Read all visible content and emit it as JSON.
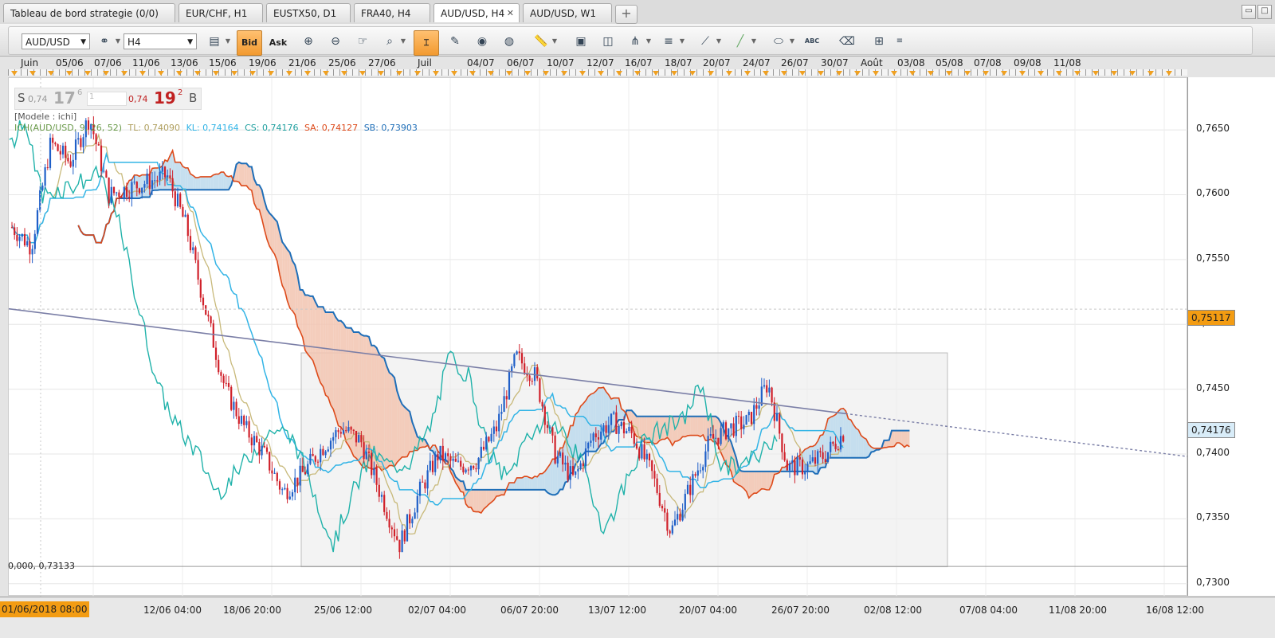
{
  "tabs": [
    {
      "label": "Tableau de bord strategie (0/0)",
      "active": false
    },
    {
      "label": "EUR/CHF, H1",
      "active": false
    },
    {
      "label": "EUSTX50, D1",
      "active": false
    },
    {
      "label": "FRA40, H4",
      "active": false
    },
    {
      "label": "AUD/USD, H4",
      "active": true
    },
    {
      "label": "AUD/USD, W1",
      "active": false
    }
  ],
  "tab_add_label": "+",
  "toolbar": {
    "instrument": "AUD/USD",
    "timeframe": "H4",
    "bid_label": "Bid",
    "ask_label": "Ask",
    "text_tool_label": "ABC",
    "icons": [
      "chart-type-icon",
      "bar-style-icon",
      "zoom-in-icon",
      "zoom-out-icon",
      "hand-icon",
      "zoom-fit-icon",
      "crosshair-icon",
      "template-icon",
      "eye-icon",
      "globe-icon",
      "ruler-icon",
      "image-icon",
      "window-icon",
      "pitchfork-icon",
      "lines-icon",
      "trendline-icon",
      "pen-icon",
      "ellipse-icon",
      "text-icon",
      "eraser-icon",
      "hierarchy-icon",
      "more-icon"
    ]
  },
  "date_axis_top": [
    "Juin",
    "05/06",
    "07/06",
    "11/06",
    "13/06",
    "15/06",
    "19/06",
    "21/06",
    "25/06",
    "27/06",
    "Juil",
    "04/07",
    "06/07",
    "10/07",
    "12/07",
    "16/07",
    "18/07",
    "20/07",
    "24/07",
    "26/07",
    "30/07",
    "Août",
    "03/08",
    "05/08",
    "07/08",
    "09/08",
    "11/08"
  ],
  "time_axis_bottom": [
    "01/06/2018 08:00",
    "12/06 04:00",
    "18/06 20:00",
    "25/06 12:00",
    "02/07 04:00",
    "06/07 20:00",
    "13/07 12:00",
    "20/07 04:00",
    "26/07 20:00",
    "02/08 12:00",
    "07/08 04:00",
    "11/08 20:00",
    "16/08 12:00"
  ],
  "price_axis": [
    "0,7650",
    "0,7600",
    "0,7550",
    "0,7500",
    "0,7450",
    "0,7400",
    "0,7350",
    "0,7300"
  ],
  "price_tags": {
    "last_close": "0,75117",
    "current": "0,74176"
  },
  "quote": {
    "sell_label": "S",
    "sell_big": "0,74",
    "sell_pips": "17",
    "sell_frac": "6",
    "qty": "1",
    "buy_big": "0,74",
    "buy_pips": "19",
    "buy_frac": "2",
    "buy_label": "B"
  },
  "legend": {
    "model": "[Modele : ichi]",
    "ich": "ICH(AUD/USD, 9, 26, 52)",
    "tl": "TL: 0,74090",
    "kl": "KL: 0,74164",
    "cs": "CS: 0,74176",
    "sa": "SA: 0,74127",
    "sb": "SB: 0,73903"
  },
  "fib_label": "0,000, 0,73133",
  "colors": {
    "tenkan": "#c8b97a",
    "kijun": "#32b4e6",
    "chikou": "#20b2aa",
    "span_a": "#dd4a1a",
    "span_b": "#1e6eb8",
    "cloud_bull": "#bcd9ec",
    "cloud_bear": "#f2c4b0",
    "candle_up": "#1f5fc8",
    "candle_down": "#d0202a",
    "trendline": "#7a7ea6",
    "highlight": "#f39c12"
  },
  "chart_data": {
    "type": "candlestick",
    "symbol": "AUD/USD",
    "timeframe": "H4",
    "ylim": [
      0.729,
      0.769
    ],
    "x_range": [
      "01/06/2018 08:00",
      "17/08/2018 12:00"
    ],
    "y_ticks": [
      0.73,
      0.735,
      0.74,
      0.745,
      0.75,
      0.755,
      0.76,
      0.765
    ],
    "close_path": [
      [
        "01/06",
        0.7575
      ],
      [
        "04/06",
        0.756
      ],
      [
        "05/06",
        0.764
      ],
      [
        "06/06",
        0.7625
      ],
      [
        "07/06",
        0.766
      ],
      [
        "08/06",
        0.76
      ],
      [
        "11/06",
        0.7605
      ],
      [
        "12/06",
        0.761
      ],
      [
        "13/06",
        0.7615
      ],
      [
        "14/06",
        0.7575
      ],
      [
        "15/06",
        0.751
      ],
      [
        "18/06",
        0.745
      ],
      [
        "19/06",
        0.742
      ],
      [
        "20/06",
        0.74
      ],
      [
        "21/06",
        0.737
      ],
      [
        "22/06",
        0.7385
      ],
      [
        "25/06",
        0.7405
      ],
      [
        "26/06",
        0.742
      ],
      [
        "27/06",
        0.741
      ],
      [
        "28/06",
        0.737
      ],
      [
        "29/06",
        0.733
      ],
      [
        "02/07",
        0.737
      ],
      [
        "03/07",
        0.74
      ],
      [
        "04/07",
        0.739
      ],
      [
        "05/07",
        0.7395
      ],
      [
        "06/07",
        0.742
      ],
      [
        "09/07",
        0.7475
      ],
      [
        "10/07",
        0.746
      ],
      [
        "11/07",
        0.74
      ],
      [
        "12/07",
        0.738
      ],
      [
        "13/07",
        0.7415
      ],
      [
        "16/07",
        0.7425
      ],
      [
        "17/07",
        0.7415
      ],
      [
        "18/07",
        0.7385
      ],
      [
        "19/07",
        0.734
      ],
      [
        "20/07",
        0.7375
      ],
      [
        "23/07",
        0.741
      ],
      [
        "24/07",
        0.742
      ],
      [
        "25/07",
        0.7425
      ],
      [
        "26/07",
        0.7455
      ],
      [
        "27/07",
        0.739
      ],
      [
        "30/07",
        0.739
      ],
      [
        "31/07",
        0.74
      ],
      [
        "01/08",
        0.7418
      ]
    ],
    "indicators": {
      "ichimoku": {
        "tenkan": 0.7409,
        "kijun": 0.74164,
        "chikou": 0.74176,
        "span_a": 0.74127,
        "span_b": 0.73903
      }
    },
    "trendline": {
      "start": [
        "01/06/2018 08:00",
        0.7512
      ],
      "end": [
        "17/08/2018 12:00",
        0.7398
      ]
    },
    "consolidation_box": {
      "from": "22/06",
      "to": "05/08",
      "low": 0.7313,
      "high": 0.7478
    },
    "horizontal_levels": [
      0.73133,
      0.75117
    ]
  }
}
